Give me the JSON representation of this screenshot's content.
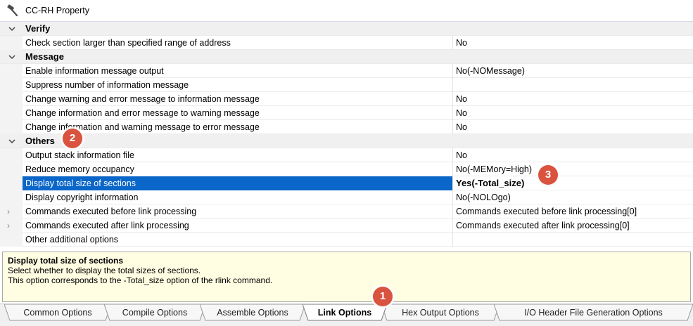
{
  "window": {
    "title": "CC-RH Property"
  },
  "categories": {
    "verify": "Verify",
    "message": "Message",
    "others": "Others"
  },
  "properties": [
    {
      "name": "Check section larger than specified range of address",
      "value": "No"
    },
    {
      "name": "Enable information message output",
      "value": "No(-NOMessage)"
    },
    {
      "name": "Suppress number of information message",
      "value": ""
    },
    {
      "name": "Change warning and error message to information message",
      "value": "No"
    },
    {
      "name": "Change information and error message to warning message",
      "value": "No"
    },
    {
      "name": "Change information and warning message to error message",
      "value": "No"
    },
    {
      "name": "Output stack information file",
      "value": "No"
    },
    {
      "name": "Reduce memory occupancy",
      "value": "No(-MEMory=High)"
    },
    {
      "name": "Display total size of sections",
      "value": "Yes(-Total_size)"
    },
    {
      "name": "Display copyright information",
      "value": "No(-NOLOgo)"
    },
    {
      "name": "Commands executed before link processing",
      "value": "Commands executed before link processing[0]"
    },
    {
      "name": "Commands executed after link processing",
      "value": "Commands executed after link processing[0]"
    },
    {
      "name": "Other additional options",
      "value": ""
    }
  ],
  "description": {
    "title": "Display total size of sections",
    "line1": "Select whether to display the total sizes of sections.",
    "line2": "This option corresponds to the -Total_size option of the rlink command."
  },
  "tabs": [
    "Common Options",
    "Compile Options",
    "Assemble Options",
    "Link Options",
    "Hex Output Options",
    "I/O Header File Generation Options"
  ],
  "active_tab": "Link Options",
  "badges": [
    "1",
    "2",
    "3"
  ],
  "colors": {
    "selection": "#0a66c8",
    "badge": "#d9533f",
    "description_bg": "#fffde2"
  }
}
